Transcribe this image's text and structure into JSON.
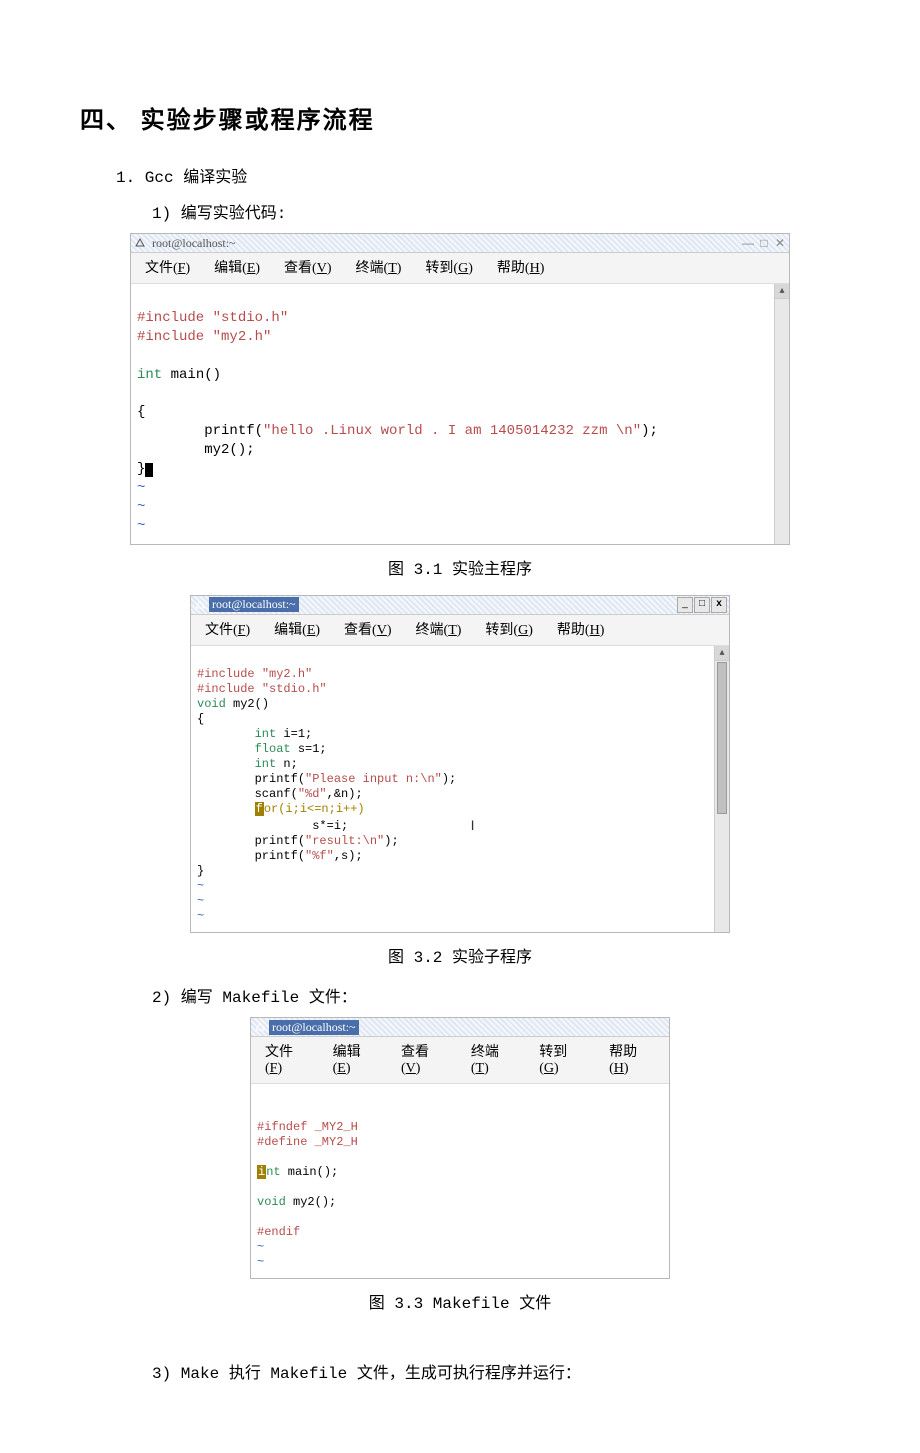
{
  "section_title": "四、 实验步骤或程序流程",
  "item1": "1.  Gcc 编译实验",
  "item1_1": "1)  编写实验代码:",
  "item1_2": "2)  编写 Makefile 文件：",
  "item1_3": "3)  Make 执行 Makefile 文件，生成可执行程序并运行：",
  "fig1_caption": "图 3.1 实验主程序",
  "fig2_caption": "图 3.2 实验子程序",
  "fig3_caption": "图 3.3 Makefile 文件",
  "term_title_plain": "root@localhost:~",
  "term_title_sel": "root@localhost:~",
  "menus": {
    "file": "文件(F)",
    "edit": "编辑(E)",
    "view": "查看(V)",
    "terminal": "终端(T)",
    "go": "转到(G)",
    "help": "帮助(H)"
  },
  "win_btns": {
    "min": "_",
    "max": "□",
    "close": "x"
  },
  "flat_btns": {
    "min": "—",
    "max": "□",
    "close": "✕"
  },
  "code1": {
    "l1a": "#include ",
    "l1b": "\"stdio.h\"",
    "l2a": "#include ",
    "l2b": "\"my2.h\"",
    "l3a": "int",
    "l3b": " main()",
    "l4": "{",
    "l5a": "        printf(",
    "l5b": "\"hello .Linux world . I am 1405014232 zzm \\n\"",
    "l5c": ");",
    "l6": "        my2();",
    "l7": "}"
  },
  "code2": {
    "l1a": "#include ",
    "l1b": "\"my2.h\"",
    "l2a": "#include ",
    "l2b": "\"stdio.h\"",
    "l3a": "void",
    "l3b": " my2()",
    "l4": "{",
    "l5a": "        int",
    "l5b": " i=1;",
    "l6a": "        float",
    "l6b": " s=1;",
    "l7a": "        int",
    "l7b": " n;",
    "l8a": "        printf(",
    "l8b": "\"Please input n:\\n\"",
    "l8c": ");",
    "l9a": "        scanf(",
    "l9b": "\"%d\"",
    "l9c": ",&n);",
    "l10a": "        ",
    "l10f": "f",
    "l10b": "or(i;i<=n;i++)",
    "l11": "                s*=i;",
    "l12a": "        printf(",
    "l12b": "\"result:\\n\"",
    "l12c": ");",
    "l13a": "        printf(",
    "l13b": "\"%f\"",
    "l13c": ",s);",
    "l14": "}"
  },
  "code3": {
    "l1": "#ifndef _MY2_H",
    "l2": "#define _MY2_H",
    "l3a": "i",
    "l3b": "nt",
    "l3c": " main();",
    "l4a": "void",
    "l4b": " my2();",
    "l5": "#endif"
  }
}
